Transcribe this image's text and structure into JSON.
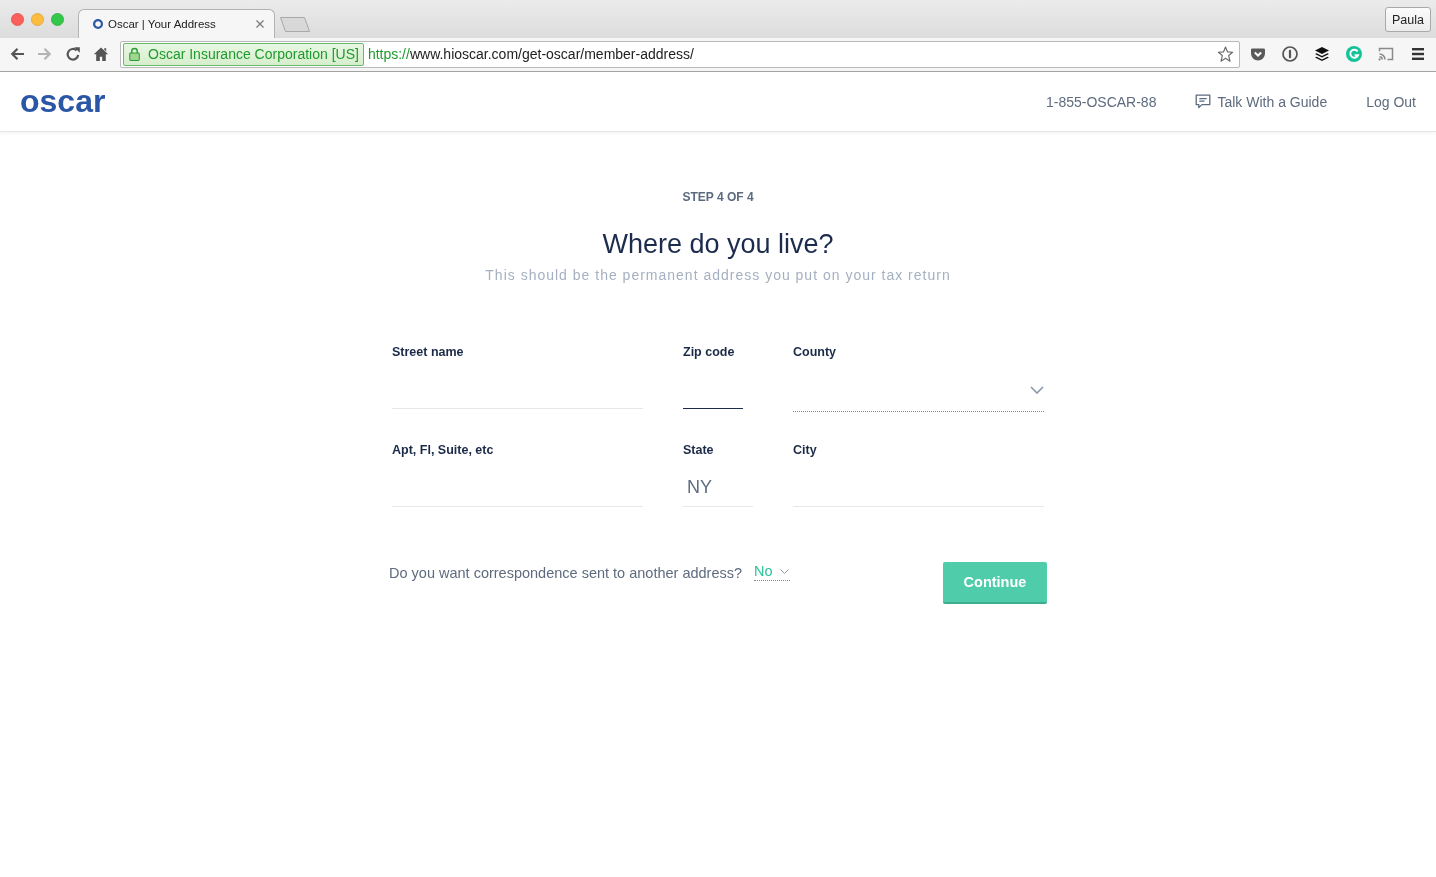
{
  "browser": {
    "tab": {
      "title": "Oscar | Your Address"
    },
    "profile": "Paula",
    "address_bar": {
      "identity": "Oscar Insurance Corporation [US]",
      "scheme": "https://",
      "url": "www.hioscar.com/get-oscar/member-address/"
    }
  },
  "header": {
    "logo": "oscar",
    "links": [
      {
        "label": "1-855-OSCAR-88",
        "kind": "phone"
      },
      {
        "label": "Talk With a Guide",
        "kind": "chat"
      },
      {
        "label": "Log Out",
        "kind": "plain"
      }
    ]
  },
  "form": {
    "step": "STEP 4 OF 4",
    "title": "Where do you live?",
    "subtitle": "This should be the permanent address you put on your tax return",
    "fields": [
      {
        "label": "Street name",
        "kind": "input",
        "focused": false
      },
      {
        "label": "Zip code",
        "kind": "input",
        "focused": true
      },
      {
        "label": "County",
        "kind": "select",
        "focused": false
      },
      {
        "label": "Apt, Fl, Suite, etc",
        "kind": "input",
        "focused": false
      },
      {
        "label": "State",
        "kind": "input",
        "value": "NY",
        "focused": false
      },
      {
        "label": "City",
        "kind": "input",
        "focused": false
      }
    ],
    "correspondence": {
      "question": "Do you want correspondence sent to another address?",
      "answer": "No"
    },
    "continue_button": "Continue"
  }
}
